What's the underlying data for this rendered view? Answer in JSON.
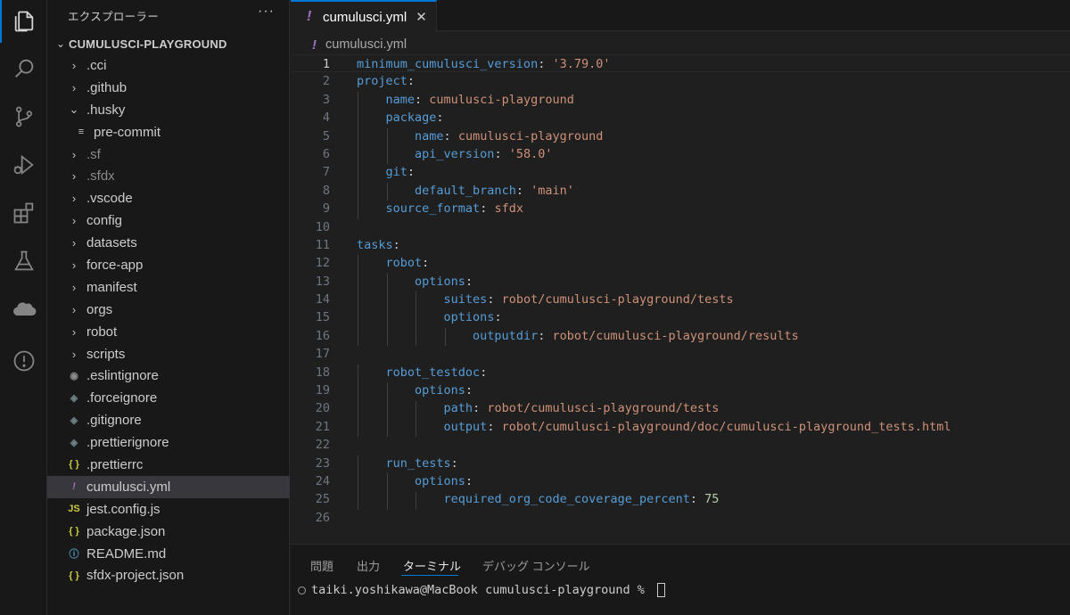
{
  "sidebar": {
    "title": "エクスプローラー",
    "more": "···",
    "root": "CUMULUSCI-PLAYGROUND",
    "items": [
      {
        "label": ".cci",
        "type": "folder",
        "expanded": false,
        "indent": 1
      },
      {
        "label": ".github",
        "type": "folder",
        "expanded": false,
        "indent": 1
      },
      {
        "label": ".husky",
        "type": "folder",
        "expanded": true,
        "indent": 1
      },
      {
        "label": "pre-commit",
        "type": "file",
        "icon": "lines",
        "indent": 2
      },
      {
        "label": ".sf",
        "type": "folder",
        "expanded": false,
        "indent": 1,
        "dim": true
      },
      {
        "label": ".sfdx",
        "type": "folder",
        "expanded": false,
        "indent": 1,
        "dim": true
      },
      {
        "label": ".vscode",
        "type": "folder",
        "expanded": false,
        "indent": 1
      },
      {
        "label": "config",
        "type": "folder",
        "expanded": false,
        "indent": 1
      },
      {
        "label": "datasets",
        "type": "folder",
        "expanded": false,
        "indent": 1
      },
      {
        "label": "force-app",
        "type": "folder",
        "expanded": false,
        "indent": 1
      },
      {
        "label": "manifest",
        "type": "folder",
        "expanded": false,
        "indent": 1
      },
      {
        "label": "orgs",
        "type": "folder",
        "expanded": false,
        "indent": 1
      },
      {
        "label": "robot",
        "type": "folder",
        "expanded": false,
        "indent": 1
      },
      {
        "label": "scripts",
        "type": "folder",
        "expanded": false,
        "indent": 1
      },
      {
        "label": ".eslintignore",
        "type": "file",
        "icon": "circle",
        "indent": 1
      },
      {
        "label": ".forceignore",
        "type": "file",
        "icon": "diamond",
        "indent": 1
      },
      {
        "label": ".gitignore",
        "type": "file",
        "icon": "diamond",
        "indent": 1
      },
      {
        "label": ".prettierignore",
        "type": "file",
        "icon": "diamond",
        "indent": 1
      },
      {
        "label": ".prettierrc",
        "type": "file",
        "icon": "braces",
        "indent": 1
      },
      {
        "label": "cumulusci.yml",
        "type": "file",
        "icon": "bang",
        "indent": 1,
        "selected": true
      },
      {
        "label": "jest.config.js",
        "type": "file",
        "icon": "js",
        "indent": 1
      },
      {
        "label": "package.json",
        "type": "file",
        "icon": "braces",
        "indent": 1
      },
      {
        "label": "README.md",
        "type": "file",
        "icon": "info",
        "indent": 1
      },
      {
        "label": "sfdx-project.json",
        "type": "file",
        "icon": "braces",
        "indent": 1
      }
    ]
  },
  "editor": {
    "tab_label": "cumulusci.yml",
    "tab_icon": "!",
    "close_glyph": "✕",
    "breadcrumb": "cumulusci.yml",
    "current_line": 1,
    "lines": [
      [
        [
          "k",
          "minimum_cumulusci_version"
        ],
        [
          "p",
          ": "
        ],
        [
          "s",
          "'3.79.0'"
        ]
      ],
      [
        [
          "k",
          "project"
        ],
        [
          "p",
          ":"
        ]
      ],
      [
        [
          "p",
          "    "
        ],
        [
          "k",
          "name"
        ],
        [
          "p",
          ": "
        ],
        [
          "s",
          "cumulusci-playground"
        ]
      ],
      [
        [
          "p",
          "    "
        ],
        [
          "k",
          "package"
        ],
        [
          "p",
          ":"
        ]
      ],
      [
        [
          "p",
          "        "
        ],
        [
          "k",
          "name"
        ],
        [
          "p",
          ": "
        ],
        [
          "s",
          "cumulusci-playground"
        ]
      ],
      [
        [
          "p",
          "        "
        ],
        [
          "k",
          "api_version"
        ],
        [
          "p",
          ": "
        ],
        [
          "s",
          "'58.0'"
        ]
      ],
      [
        [
          "p",
          "    "
        ],
        [
          "k",
          "git"
        ],
        [
          "p",
          ":"
        ]
      ],
      [
        [
          "p",
          "        "
        ],
        [
          "k",
          "default_branch"
        ],
        [
          "p",
          ": "
        ],
        [
          "s",
          "'main'"
        ]
      ],
      [
        [
          "p",
          "    "
        ],
        [
          "k",
          "source_format"
        ],
        [
          "p",
          ": "
        ],
        [
          "s",
          "sfdx"
        ]
      ],
      [],
      [
        [
          "k",
          "tasks"
        ],
        [
          "p",
          ":"
        ]
      ],
      [
        [
          "p",
          "    "
        ],
        [
          "k",
          "robot"
        ],
        [
          "p",
          ":"
        ]
      ],
      [
        [
          "p",
          "        "
        ],
        [
          "k",
          "options"
        ],
        [
          "p",
          ":"
        ]
      ],
      [
        [
          "p",
          "            "
        ],
        [
          "k",
          "suites"
        ],
        [
          "p",
          ": "
        ],
        [
          "s",
          "robot/cumulusci-playground/tests"
        ]
      ],
      [
        [
          "p",
          "            "
        ],
        [
          "k",
          "options"
        ],
        [
          "p",
          ":"
        ]
      ],
      [
        [
          "p",
          "                "
        ],
        [
          "k",
          "outputdir"
        ],
        [
          "p",
          ": "
        ],
        [
          "s",
          "robot/cumulusci-playground/results"
        ]
      ],
      [],
      [
        [
          "p",
          "    "
        ],
        [
          "k",
          "robot_testdoc"
        ],
        [
          "p",
          ":"
        ]
      ],
      [
        [
          "p",
          "        "
        ],
        [
          "k",
          "options"
        ],
        [
          "p",
          ":"
        ]
      ],
      [
        [
          "p",
          "            "
        ],
        [
          "k",
          "path"
        ],
        [
          "p",
          ": "
        ],
        [
          "s",
          "robot/cumulusci-playground/tests"
        ]
      ],
      [
        [
          "p",
          "            "
        ],
        [
          "k",
          "output"
        ],
        [
          "p",
          ": "
        ],
        [
          "s",
          "robot/cumulusci-playground/doc/cumulusci-playground_tests.html"
        ]
      ],
      [],
      [
        [
          "p",
          "    "
        ],
        [
          "k",
          "run_tests"
        ],
        [
          "p",
          ":"
        ]
      ],
      [
        [
          "p",
          "        "
        ],
        [
          "k",
          "options"
        ],
        [
          "p",
          ":"
        ]
      ],
      [
        [
          "p",
          "            "
        ],
        [
          "k",
          "required_org_code_coverage_percent"
        ],
        [
          "p",
          ": "
        ],
        [
          "n",
          "75"
        ]
      ],
      []
    ]
  },
  "panel": {
    "tabs": [
      "問題",
      "出力",
      "ターミナル",
      "デバッグ コンソール"
    ],
    "active_tab": 2,
    "prompt": "taiki.yoshikawa@MacBook cumulusci-playground % "
  },
  "activity": [
    {
      "name": "explorer-icon",
      "active": true
    },
    {
      "name": "search-icon"
    },
    {
      "name": "source-control-icon"
    },
    {
      "name": "run-debug-icon"
    },
    {
      "name": "extensions-icon"
    },
    {
      "name": "testing-icon"
    },
    {
      "name": "salesforce-cloud-icon"
    },
    {
      "name": "warning-icon"
    }
  ],
  "colors": {
    "accent": "#0078d4",
    "key": "#569cd6",
    "string": "#ce9178",
    "number": "#b5cea8"
  }
}
